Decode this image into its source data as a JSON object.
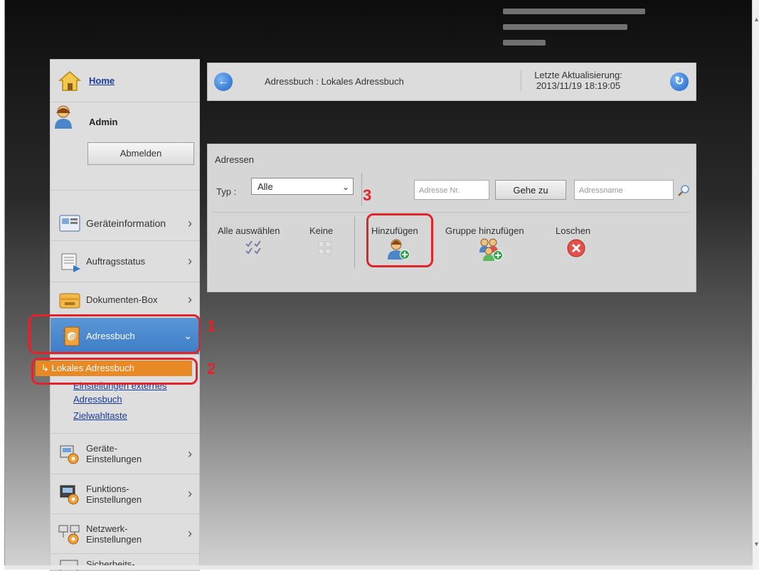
{
  "sidebar": {
    "home_label": "Home",
    "admin_label": "Admin",
    "logout_label": "Abmelden",
    "items": [
      {
        "label": "Geräteinformation"
      },
      {
        "label": "Auftragsstatus"
      },
      {
        "label": "Dokumenten-Box"
      },
      {
        "label": "Adressbuch"
      },
      {
        "label": "Geräte-\nEinstellungen"
      },
      {
        "label": "Funktions-\nEinstellungen"
      },
      {
        "label": "Netzwerk-\nEinstellungen"
      },
      {
        "label": "Sicherheits-"
      }
    ],
    "submenu": {
      "selected": "Lokales Adressbuch",
      "links": [
        "Einstellungen externes",
        "Adressbuch",
        "Zielwahltaste"
      ]
    }
  },
  "toolbar": {
    "title": "Adressbuch : Lokales Adressbuch",
    "update_label": "Letzte Aktualisierung:",
    "update_time": "2013/11/19 18:19:05"
  },
  "panel": {
    "title": "Adressen",
    "type_label": "Typ :",
    "type_value": "Alle",
    "addr_no_placeholder": "Adresse Nr.",
    "goto_label": "Gehe zu",
    "addr_name_placeholder": "Adressname",
    "select_all": "Alle auswählen",
    "none": "Keine",
    "add": "Hinzufügen",
    "add_group": "Gruppe hinzufügen",
    "delete": "Loschen"
  },
  "annotations": {
    "n1": "1",
    "n2": "2",
    "n3": "3"
  },
  "colors": {
    "accent_red": "#e0242a",
    "selected_orange": "#e78924",
    "active_blue": "#3e7cc6"
  }
}
